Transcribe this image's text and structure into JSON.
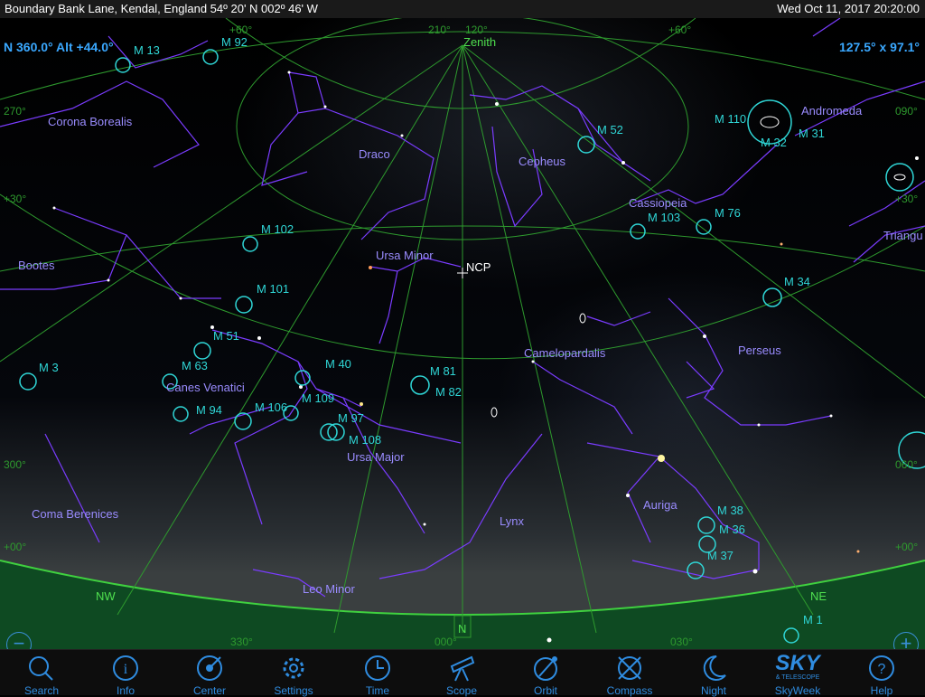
{
  "status": {
    "location": "Boundary Bank Lane, Kendal, England  54º 20' N 002º 46' W",
    "datetime": "Wed Oct 11, 2017  20:20:00"
  },
  "hud": {
    "readout": "N 360.0° Alt +44.0°",
    "fov": "127.5° x 97.1°"
  },
  "sky_labels": {
    "zenith": "Zenith",
    "ncp": "NCP",
    "constellations": [
      "Corona Borealis",
      "Draco",
      "Cepheus",
      "Andromeda",
      "Cassiopeia",
      "Bootes",
      "Ursa Minor",
      "Triangu",
      "Perseus",
      "Camelopardalis",
      "Canes Venatici",
      "Ursa Major",
      "Coma Berenices",
      "Lynx",
      "Auriga",
      "Leo Minor"
    ],
    "messier": [
      "M 13",
      "M 92",
      "M 52",
      "M 110",
      "M 32",
      "M 31",
      "M 102",
      "M 103",
      "M 76",
      "M 101",
      "M 34",
      "M 51",
      "M 63",
      "M 3",
      "M 40",
      "M 81",
      "M 82",
      "M 109",
      "M 94",
      "M 106",
      "M 97",
      "M 108",
      "M 38",
      "M 36",
      "M 37",
      "M 1"
    ],
    "grid": [
      "210°",
      "120°",
      "+60°",
      "+60°",
      "270°",
      "090°",
      "+30°",
      "+30°",
      "300°",
      "060°",
      "+00°",
      "+00°",
      "330°",
      "000°",
      "030°"
    ],
    "compass": [
      "NW",
      "NE"
    ],
    "marker": "N"
  },
  "zoom": {
    "out": "−",
    "in": "+"
  },
  "toolbar": [
    {
      "label": "Search",
      "icon": "search-icon"
    },
    {
      "label": "Info",
      "icon": "info-icon"
    },
    {
      "label": "Center",
      "icon": "center-icon"
    },
    {
      "label": "Settings",
      "icon": "gear-icon"
    },
    {
      "label": "Time",
      "icon": "clock-icon"
    },
    {
      "label": "Scope",
      "icon": "telescope-icon"
    },
    {
      "label": "Orbit",
      "icon": "orbit-icon"
    },
    {
      "label": "Compass",
      "icon": "compass-icon"
    },
    {
      "label": "Night",
      "icon": "moon-icon"
    },
    {
      "label": "SkyWeek",
      "icon": "sky-telescope-logo",
      "logo_text": "SKY",
      "logo_sub": "& TELESCOPE"
    },
    {
      "label": "Help",
      "icon": "help-icon"
    }
  ],
  "colors": {
    "grid": "#2e9a2e",
    "constellation_line": "#7a3cff",
    "constellation_label": "#9a8cff",
    "messier": "#2fd6d6",
    "horizon": "#2f9a2f",
    "toolbar_blue": "#2f8ce0",
    "hud_blue": "#3aa8ff"
  }
}
